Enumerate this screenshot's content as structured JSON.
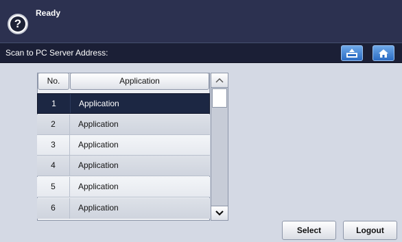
{
  "status": {
    "text": "Ready"
  },
  "title_bar": {
    "text": "Scan to PC Server Address:"
  },
  "table": {
    "headers": {
      "no": "No.",
      "application": "Application"
    },
    "rows": [
      {
        "no": "1",
        "application": "Application",
        "selected": true
      },
      {
        "no": "2",
        "application": "Application"
      },
      {
        "no": "3",
        "application": "Application"
      },
      {
        "no": "4",
        "application": "Application"
      },
      {
        "no": "5",
        "application": "Application"
      },
      {
        "no": "6",
        "application": "Application"
      }
    ]
  },
  "buttons": {
    "select": "Select",
    "logout": "Logout"
  },
  "colors": {
    "status_bg": "#2c3150",
    "title_bg": "#1b1f36",
    "selected_row": "#1c2743",
    "accent_blue": "#2b6cc4"
  },
  "icons": [
    "help-icon",
    "upload-tray-icon",
    "home-icon",
    "chevron-up-icon",
    "chevron-down-icon"
  ]
}
